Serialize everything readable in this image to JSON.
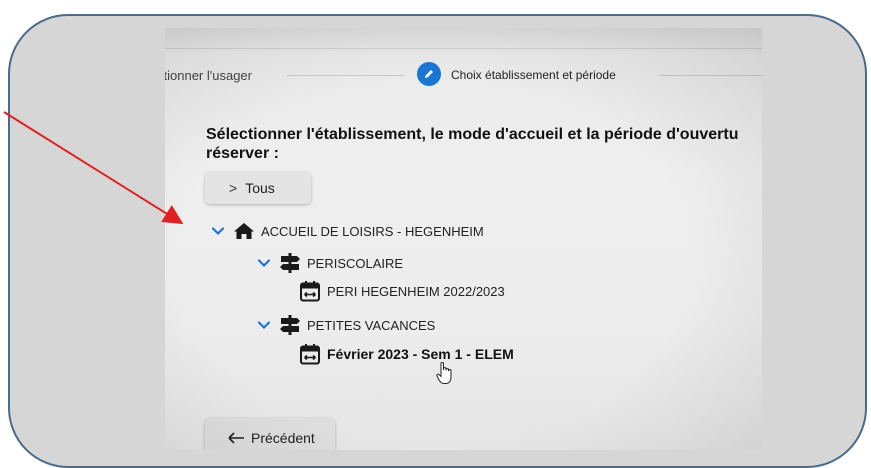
{
  "stepper": {
    "previous_step_label": "ctionner l'usager",
    "current_step_label": "Choix établissement et période"
  },
  "heading": {
    "line1": "Sélectionner l'établissement, le mode d'accueil et la période d'ouvertu",
    "line2": "réserver :"
  },
  "filter_button": {
    "label": "Tous",
    "icon": "chevron-right-icon"
  },
  "tree": {
    "establishment": {
      "label": "ACCUEIL DE LOISIRS - HEGENHEIM",
      "icon": "home-icon"
    },
    "modes": [
      {
        "label": "PERISCOLAIRE",
        "icon": "signpost-icon",
        "periods": [
          {
            "label": "PERI HEGENHEIM 2022/2023",
            "icon": "calendar-range-icon"
          }
        ]
      },
      {
        "label": "PETITES VACANCES",
        "icon": "signpost-icon",
        "periods": [
          {
            "label": "Février 2023 - Sem 1 - ELEM",
            "icon": "calendar-range-icon"
          }
        ]
      }
    ]
  },
  "back_button": {
    "label": "Précédent",
    "icon": "arrow-left-icon"
  },
  "annotation": {
    "color": "#e02020"
  },
  "colors": {
    "accent": "#1976d2",
    "frame_border": "#4a6b8a"
  }
}
